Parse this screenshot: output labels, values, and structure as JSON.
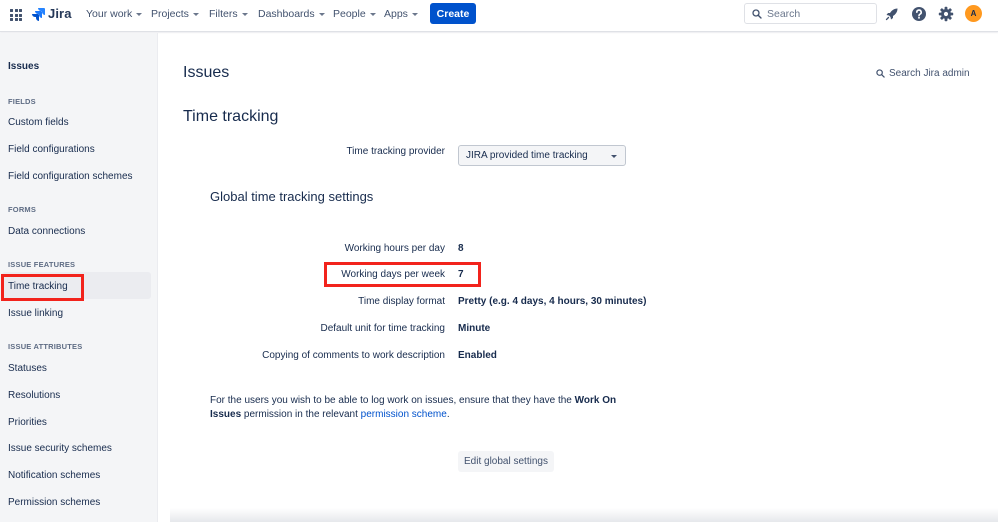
{
  "nav": {
    "logo_text": "Jira",
    "items": [
      "Your work",
      "Projects",
      "Filters",
      "Dashboards",
      "People",
      "Apps"
    ],
    "create_label": "Create",
    "search_placeholder": "Search",
    "avatar_initial": "A",
    "icons": [
      "app-switcher-icon",
      "jira-logo-icon",
      "notifications-icon",
      "help-icon",
      "settings-icon",
      "search-icon"
    ]
  },
  "sidebar": {
    "title": "Issues",
    "sections": [
      {
        "heading": "FIELDS",
        "items": [
          "Custom fields",
          "Field configurations",
          "Field configuration schemes"
        ]
      },
      {
        "heading": "FORMS",
        "items": [
          "Data connections"
        ]
      },
      {
        "heading": "ISSUE FEATURES",
        "items": [
          "Time tracking",
          "Issue linking"
        ]
      },
      {
        "heading": "ISSUE ATTRIBUTES",
        "items": [
          "Statuses",
          "Resolutions",
          "Priorities",
          "Issue security schemes",
          "Notification schemes",
          "Permission schemes"
        ]
      }
    ],
    "active_item": "Time tracking"
  },
  "main": {
    "page_title": "Issues",
    "search_admin": "Search Jira admin",
    "section_title": "Time tracking",
    "provider_label": "Time tracking provider",
    "provider_value": "JIRA provided time tracking",
    "global_title": "Global time tracking settings",
    "settings": [
      {
        "label": "Working hours per day",
        "value": "8"
      },
      {
        "label": "Working days per week",
        "value": "7"
      },
      {
        "label": "Time display format",
        "value": "Pretty (e.g. 4 days, 4 hours, 30 minutes)"
      },
      {
        "label": "Default unit for time tracking",
        "value": "Minute"
      },
      {
        "label": "Copying of comments to work description",
        "value": "Enabled"
      }
    ],
    "note": {
      "part1": "For the users you wish to be able to log work on issues, ensure that they have the ",
      "bold": "Work On Issues",
      "part2": " permission in the relevant ",
      "link": "permission scheme",
      "part3": "."
    },
    "edit_button": "Edit global settings"
  },
  "colors": {
    "brand": "#0052cc",
    "highlight": "#f2231c",
    "avatar": "#ff991f",
    "sidebar_bg": "#f4f5f7"
  }
}
